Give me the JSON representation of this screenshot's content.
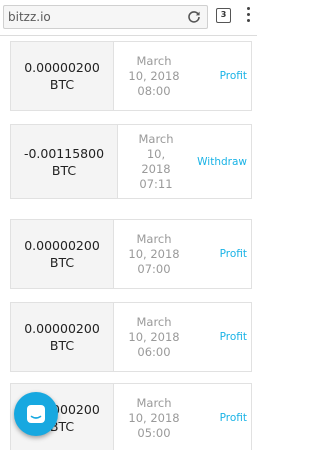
{
  "browser": {
    "url": "bitzz.io",
    "tab_count": "3"
  },
  "transactions": [
    {
      "amount_line1": "0.00000200",
      "amount_line2": "BTC",
      "date_lines": [
        "March",
        "10, 2018",
        "08:00"
      ],
      "type": "Profit"
    },
    {
      "amount_line1": "-0.00115800",
      "amount_line2": "BTC",
      "date_lines": [
        "March",
        "10,",
        "2018",
        "07:11"
      ],
      "type": "Withdraw"
    },
    {
      "amount_line1": "0.00000200",
      "amount_line2": "BTC",
      "date_lines": [
        "March",
        "10, 2018",
        "07:00"
      ],
      "type": "Profit"
    },
    {
      "amount_line1": "0.00000200",
      "amount_line2": "BTC",
      "date_lines": [
        "March",
        "10, 2018",
        "06:00"
      ],
      "type": "Profit"
    },
    {
      "amount_line1": "0.00000200",
      "amount_line2": "BTC",
      "date_lines": [
        "March",
        "10, 2018",
        "05:00"
      ],
      "type": "Profit"
    }
  ],
  "colors": {
    "accent": "#1ab3e6",
    "chat_button": "#17a8e0"
  },
  "icons": {
    "reload": "reload-icon",
    "tabs": "tabs-icon",
    "menu": "more-vert-icon",
    "chat": "chat-icon"
  }
}
